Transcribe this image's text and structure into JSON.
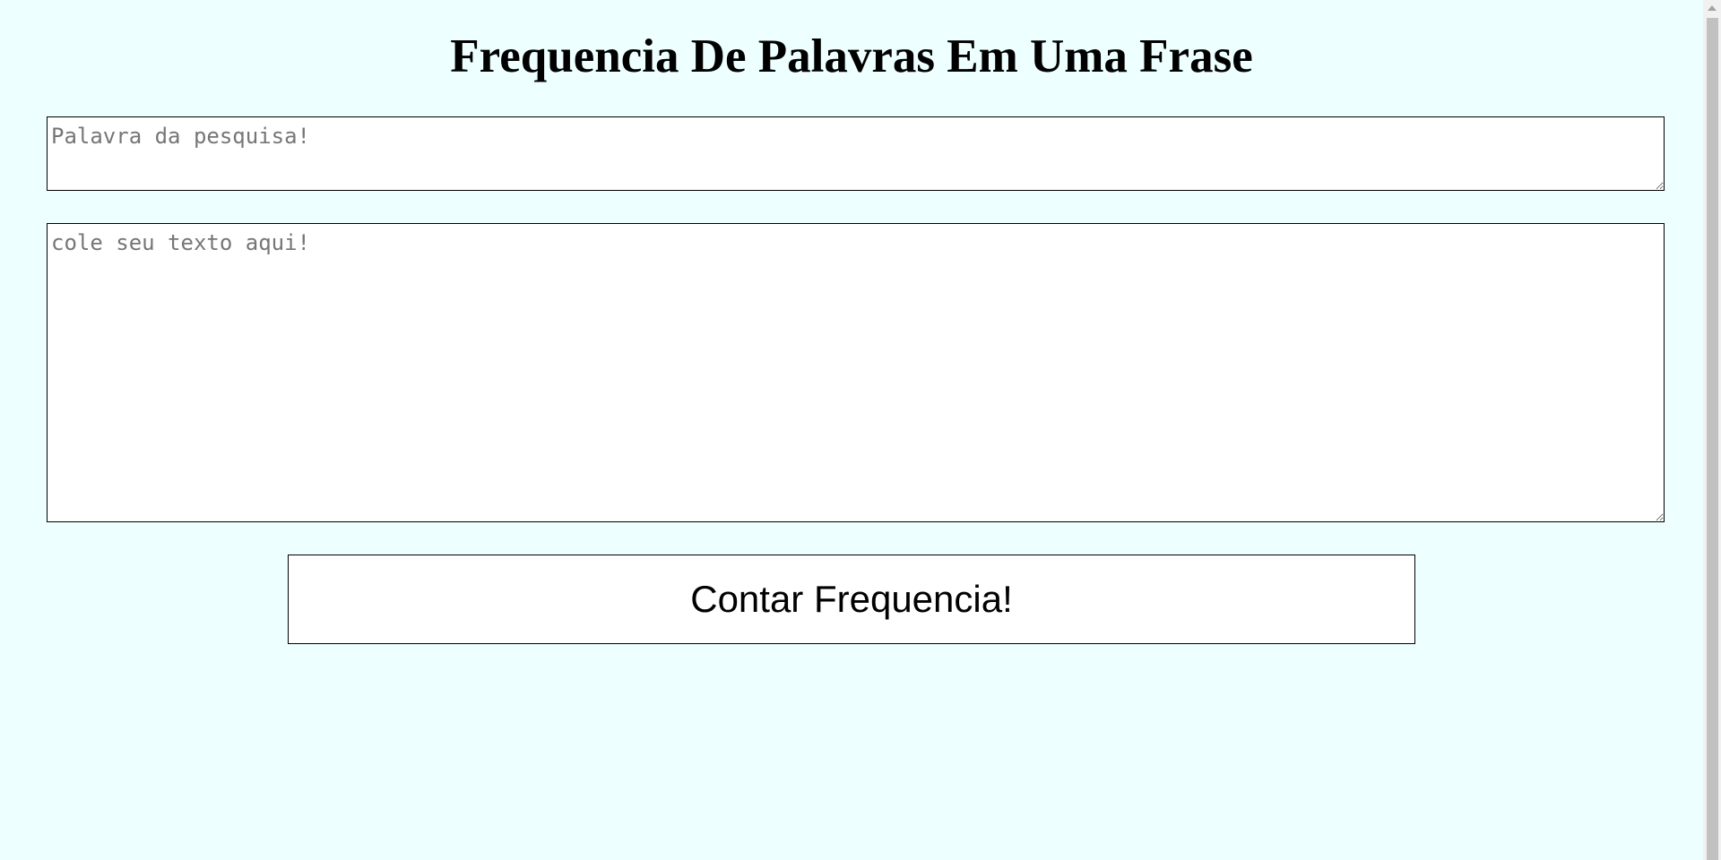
{
  "header": {
    "title": "Frequencia De Palavras Em Uma Frase"
  },
  "form": {
    "search_placeholder": "Palavra da pesquisa!",
    "search_value": "",
    "text_placeholder": "cole seu texto aqui!",
    "text_value": "",
    "submit_label": "Contar Frequencia!"
  },
  "icons": {
    "scroll_up": "scroll-up-arrow-icon"
  },
  "colors": {
    "background": "#eeffff",
    "field_background": "#ffffff",
    "border": "#000000",
    "placeholder": "#767676"
  }
}
